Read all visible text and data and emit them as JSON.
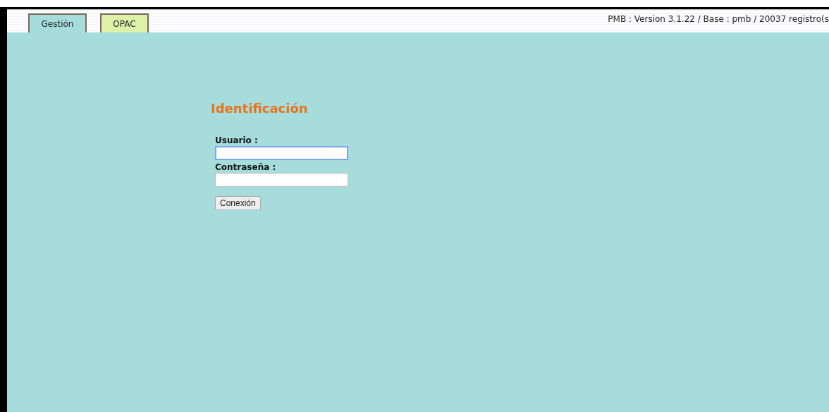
{
  "tabs": [
    {
      "label": "Gestión",
      "selected": true
    },
    {
      "label": "OPAC",
      "selected": false
    }
  ],
  "version_info": "PMB : Version 3.1.22 / Base : pmb / 20037 registro(s",
  "login": {
    "title": "Identificación",
    "fields": [
      {
        "label": "Usuario :",
        "focused": true
      },
      {
        "label": "Contraseña :",
        "focused": false
      }
    ],
    "button": "Conexión"
  }
}
